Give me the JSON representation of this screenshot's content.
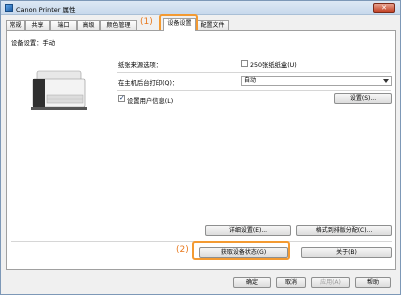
{
  "window": {
    "title": "Canon Printer 属性",
    "close_label": "✕"
  },
  "tabs": [
    {
      "label": "常规"
    },
    {
      "label": "共享"
    },
    {
      "label": "端口"
    },
    {
      "label": "高级"
    },
    {
      "label": "颜色管理"
    },
    {
      "label": "设备设置"
    },
    {
      "label": "配置文件"
    }
  ],
  "callouts": {
    "one": "(1)",
    "two": "(2)"
  },
  "panel": {
    "mode_label": "设备设置：手动",
    "paper_option_label": "纸张来源选项：",
    "paper_option_checkbox": "250张纸纸盒(U)",
    "print_on_host_label": "在主机后台打印(Q)：",
    "print_on_host_value": "自动",
    "user_info_checkbox": "设置用户信息(L)",
    "settings_button": "设置(S)...",
    "detail_button": "详细设置(E)...",
    "format_button": "格式到排版分配(C)...",
    "get_status_button": "获取设备状态(G)",
    "about_button": "关于(B)"
  },
  "footer": {
    "ok": "确定",
    "cancel": "取消",
    "apply": "应用(A)",
    "help": "帮助"
  }
}
